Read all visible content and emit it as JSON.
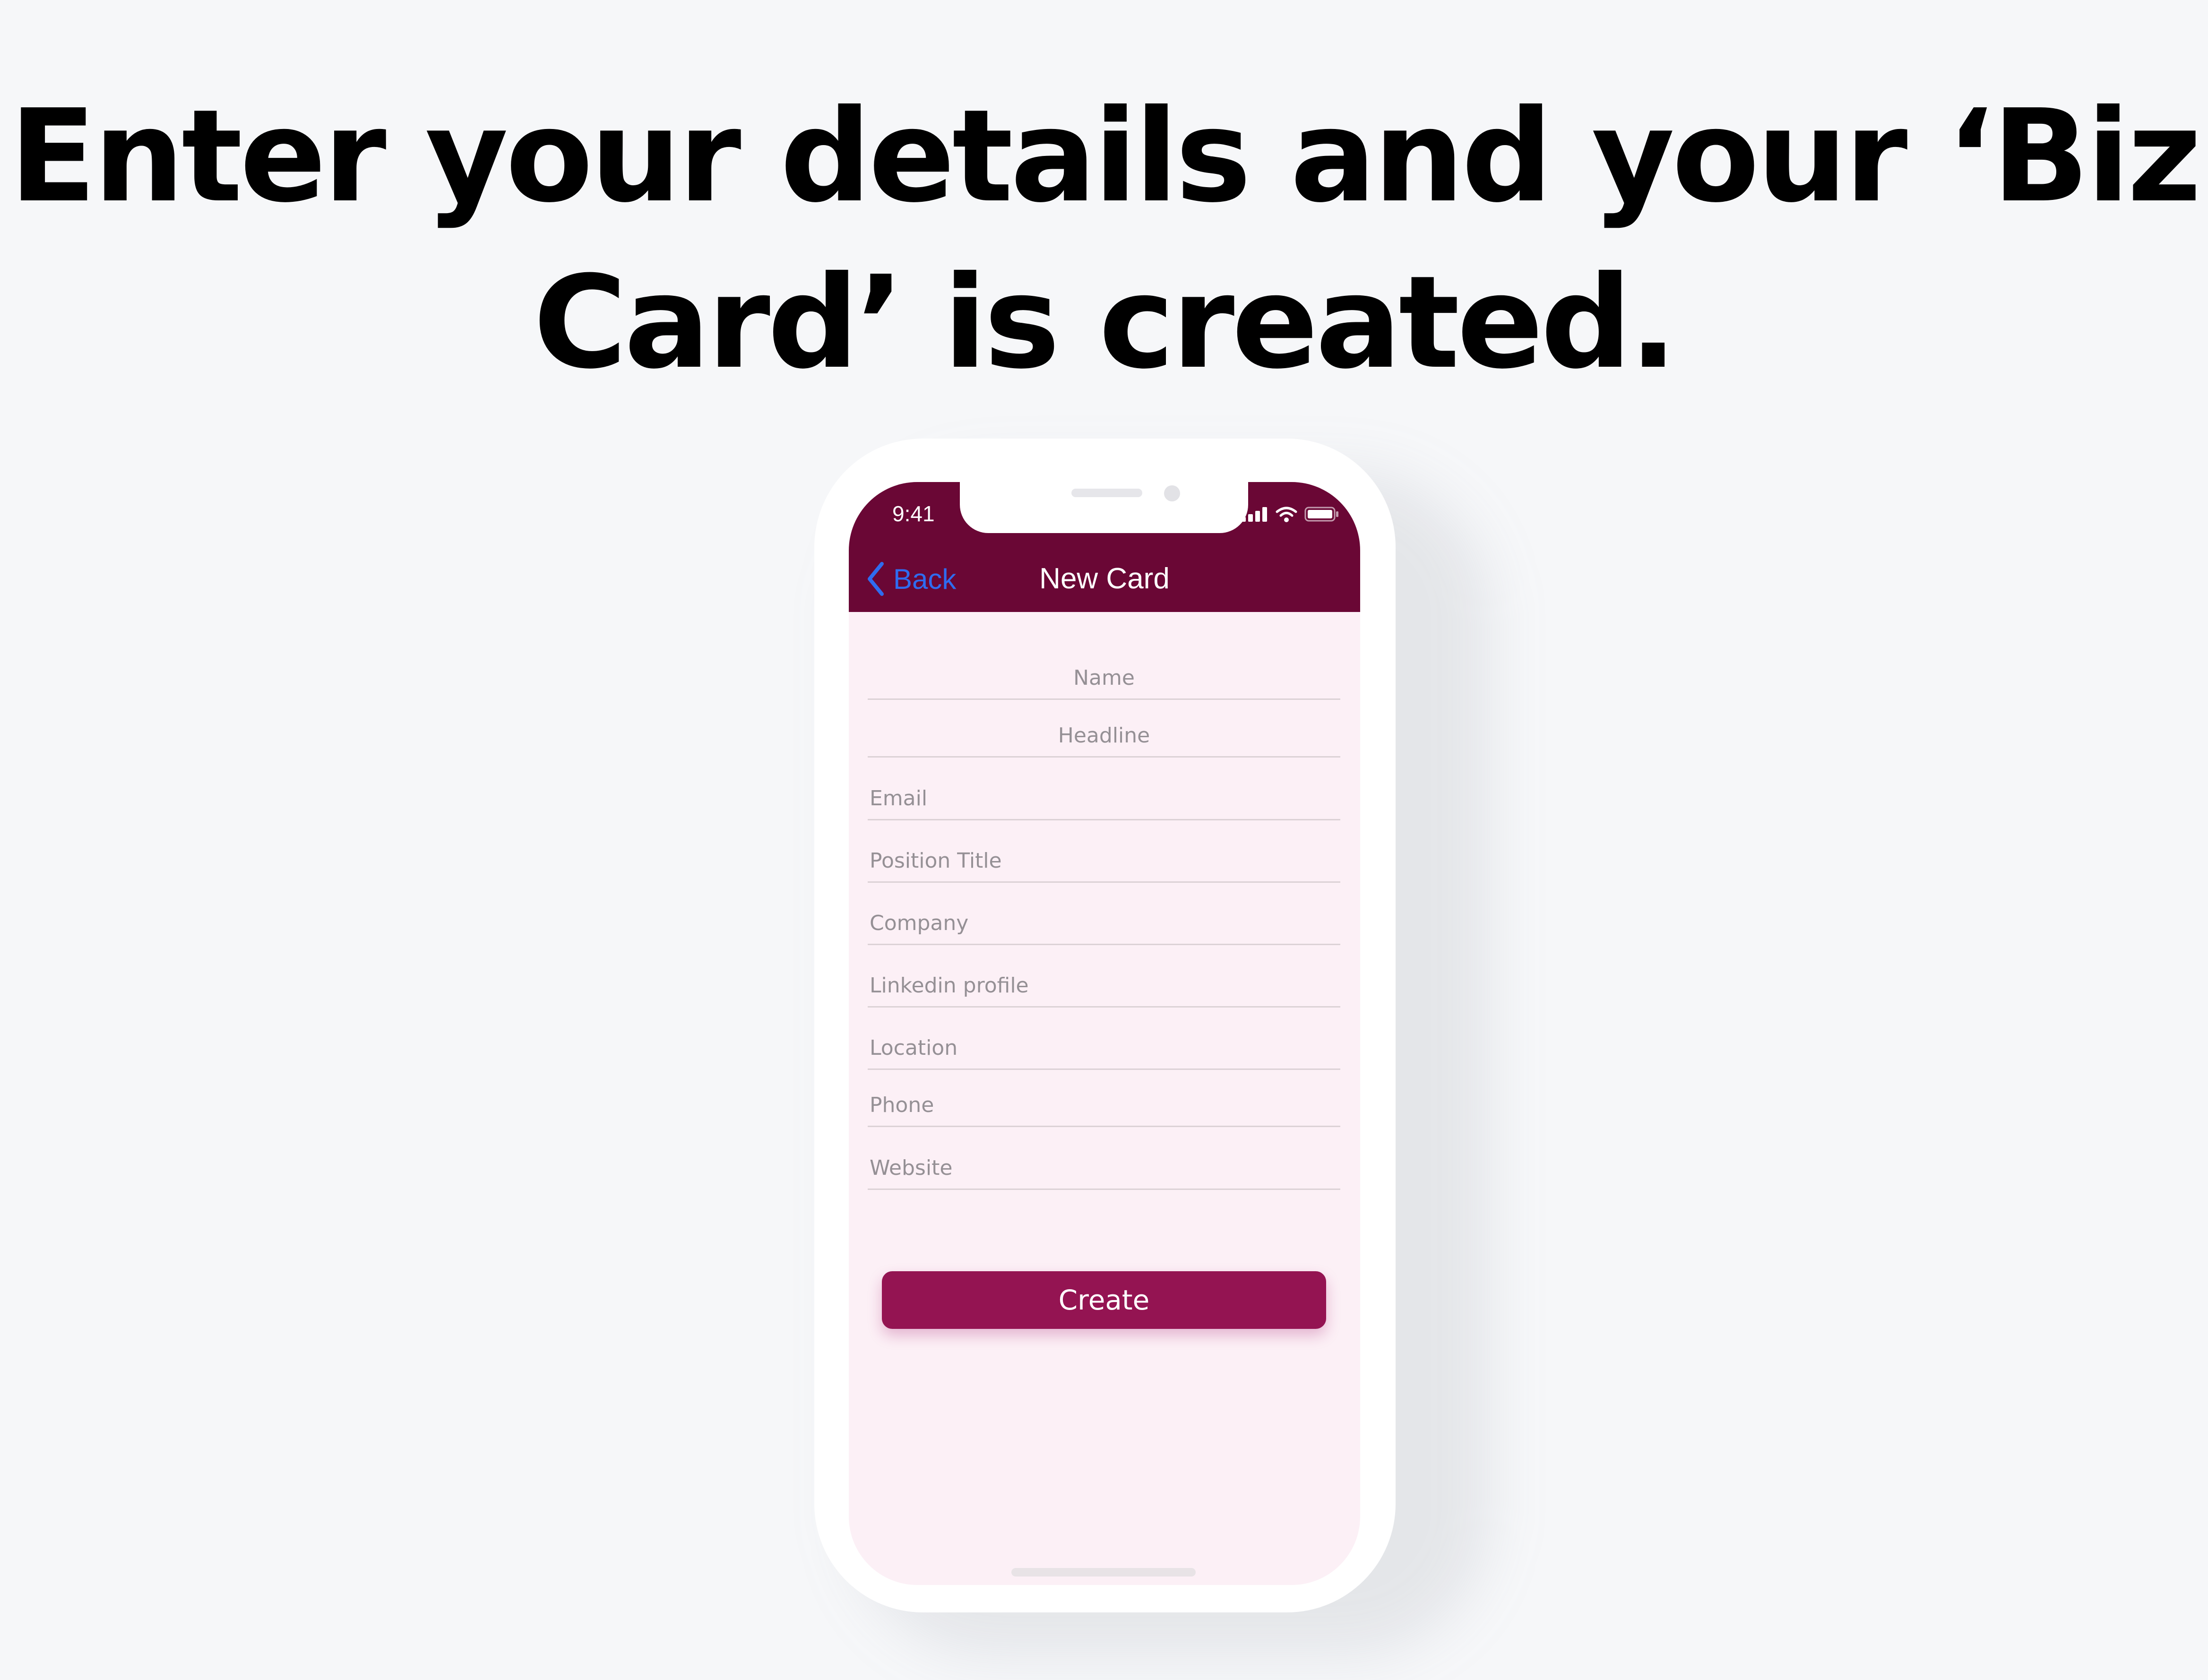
{
  "page": {
    "headline": "Enter your details and your ‘Biz Card’ is created."
  },
  "status_bar": {
    "time": "9:41",
    "icons": [
      "cellular-signal-icon",
      "wifi-icon",
      "battery-icon"
    ]
  },
  "nav": {
    "back_label": "Back",
    "title": "New Card"
  },
  "form": {
    "fields": [
      {
        "placeholder": "Name",
        "value": ""
      },
      {
        "placeholder": "Headline",
        "value": ""
      },
      {
        "placeholder": "Email",
        "value": ""
      },
      {
        "placeholder": "Position Title",
        "value": ""
      },
      {
        "placeholder": "Company",
        "value": ""
      },
      {
        "placeholder": "Linkedin profile",
        "value": ""
      },
      {
        "placeholder": "Location",
        "value": ""
      },
      {
        "placeholder": "Phone",
        "value": ""
      },
      {
        "placeholder": "Website",
        "value": ""
      }
    ],
    "submit_label": "Create"
  },
  "colors": {
    "background": "#f6f7f9",
    "nav_bar": "#6a0735",
    "screen_bg": "#fcf0f6",
    "button": "#941452",
    "back_link": "#2f6cf0"
  }
}
